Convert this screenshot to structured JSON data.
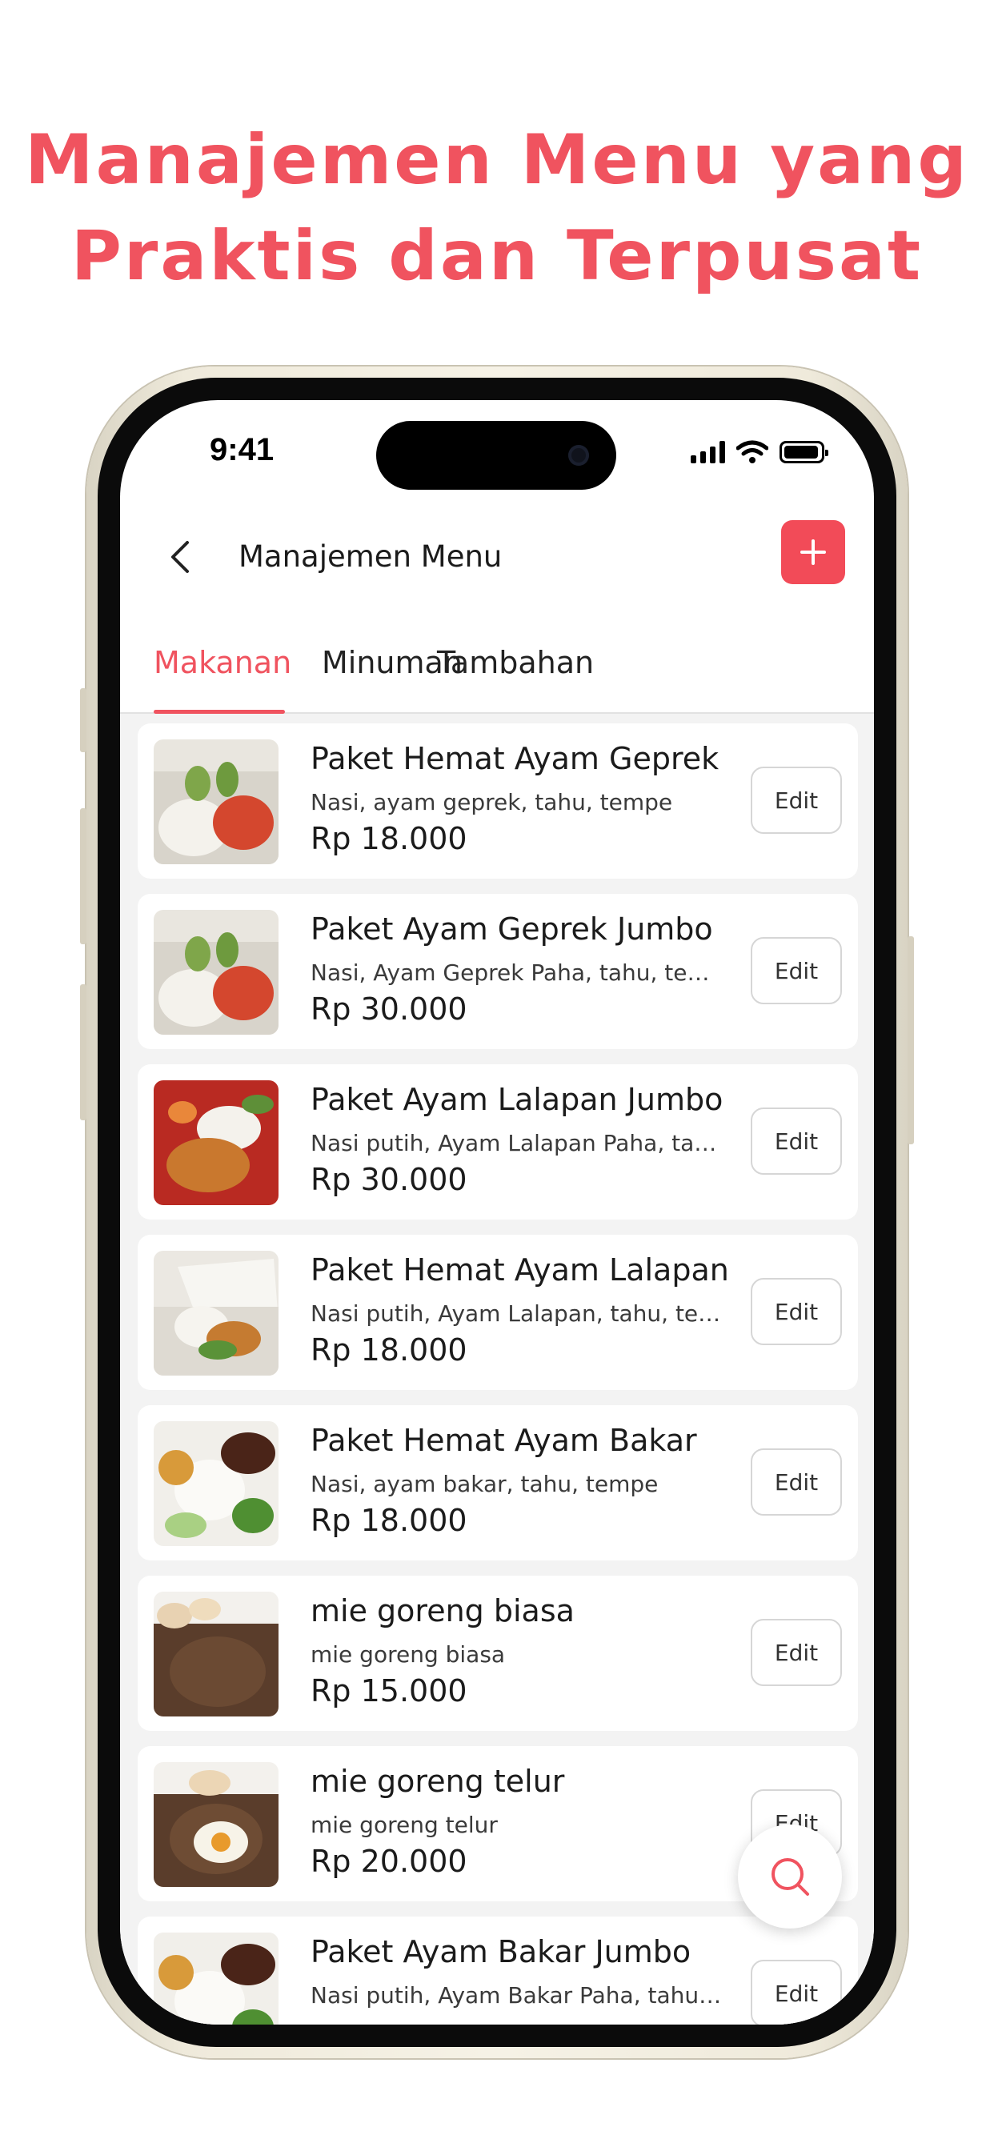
{
  "headline": {
    "line1": "Manajemen Menu yang",
    "line2": "Praktis dan Terpusat"
  },
  "status_bar": {
    "time": "9:41"
  },
  "appbar": {
    "title": "Manajemen Menu",
    "back_icon": "chevron-left-icon",
    "add_icon": "plus-icon"
  },
  "tabs": [
    {
      "label": "Makanan",
      "active": true
    },
    {
      "label": "Minuman",
      "active": false
    },
    {
      "label": "Tambahan",
      "active": false
    }
  ],
  "menu_items": [
    {
      "name": "Paket Hemat Ayam Geprek",
      "desc": "Nasi, ayam geprek, tahu, tempe",
      "price": "Rp 18.000",
      "edit": "Edit"
    },
    {
      "name": "Paket Ayam Geprek Jumbo",
      "desc": "Nasi, Ayam Geprek Paha, tahu, te…",
      "price": "Rp 30.000",
      "edit": "Edit"
    },
    {
      "name": "Paket Ayam Lalapan Jumbo",
      "desc": "Nasi putih, Ayam Lalapan Paha, ta…",
      "price": "Rp 30.000",
      "edit": "Edit"
    },
    {
      "name": "Paket Hemat Ayam Lalapan",
      "desc": "Nasi putih, Ayam Lalapan, tahu, te…",
      "price": "Rp 18.000",
      "edit": "Edit"
    },
    {
      "name": "Paket Hemat Ayam Bakar",
      "desc": "Nasi, ayam bakar, tahu, tempe",
      "price": "Rp 18.000",
      "edit": "Edit"
    },
    {
      "name": "mie goreng biasa",
      "desc": "mie goreng biasa",
      "price": "Rp 15.000",
      "edit": "Edit"
    },
    {
      "name": "mie goreng telur",
      "desc": "mie goreng telur",
      "price": "Rp 20.000",
      "edit": "Edit"
    },
    {
      "name": "Paket Ayam Bakar Jumbo",
      "desc": "Nasi putih, Ayam Bakar Paha, tahu…",
      "price": "",
      "edit": "Edit"
    }
  ],
  "fab": {
    "icon": "search-icon"
  },
  "colors": {
    "accent": "#f0535f",
    "add_button": "#f24b58"
  }
}
